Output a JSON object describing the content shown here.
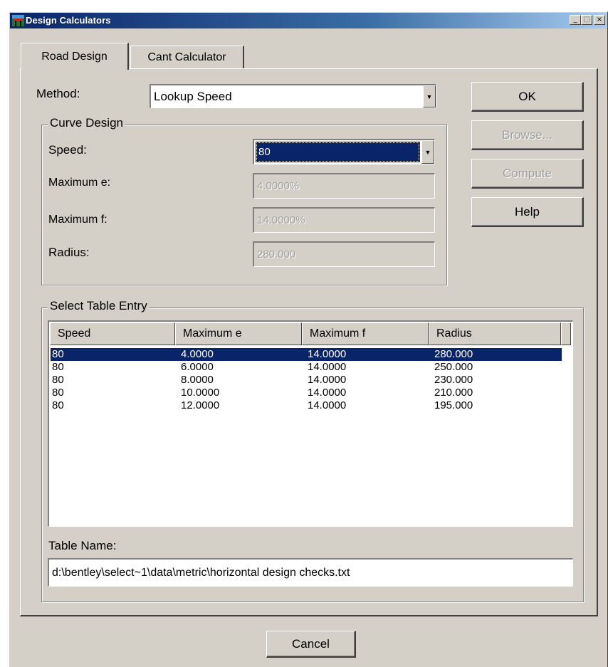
{
  "window": {
    "title": "Design Calculators"
  },
  "caption_buttons": {
    "minimize": "_",
    "maximize": "□",
    "close": "×"
  },
  "tabs": [
    {
      "label": "Road Design",
      "active": true
    },
    {
      "label": "Cant Calculator",
      "active": false
    }
  ],
  "method": {
    "label": "Method:",
    "value": "Lookup Speed"
  },
  "curve_design": {
    "title": "Curve Design",
    "speed": {
      "label": "Speed:",
      "value": "80"
    },
    "max_e": {
      "label": "Maximum e:",
      "value": "4.0000%"
    },
    "max_f": {
      "label": "Maximum f:",
      "value": "14.0000%"
    },
    "radius": {
      "label": "Radius:",
      "value": "280.000"
    }
  },
  "buttons": {
    "ok": "OK",
    "browse": "Browse...",
    "compute": "Compute",
    "help": "Help",
    "cancel": "Cancel"
  },
  "table": {
    "title": "Select Table Entry",
    "columns": [
      "Speed",
      "Maximum e",
      "Maximum f",
      "Radius"
    ],
    "rows": [
      [
        "80",
        "4.0000",
        "14.0000",
        "280.000"
      ],
      [
        "80",
        "6.0000",
        "14.0000",
        "250.000"
      ],
      [
        "80",
        "8.0000",
        "14.0000",
        "230.000"
      ],
      [
        "80",
        "10.0000",
        "14.0000",
        "210.000"
      ],
      [
        "80",
        "12.0000",
        "14.0000",
        "195.000"
      ]
    ],
    "selected_row": 0
  },
  "table_name": {
    "label": "Table Name:",
    "value": "d:\\bentley\\select~1\\data\\metric\\horizontal design checks.txt"
  },
  "colors": {
    "title_bar": "#0a246a",
    "selection": "#0a246a",
    "face": "#d4d0c8"
  }
}
